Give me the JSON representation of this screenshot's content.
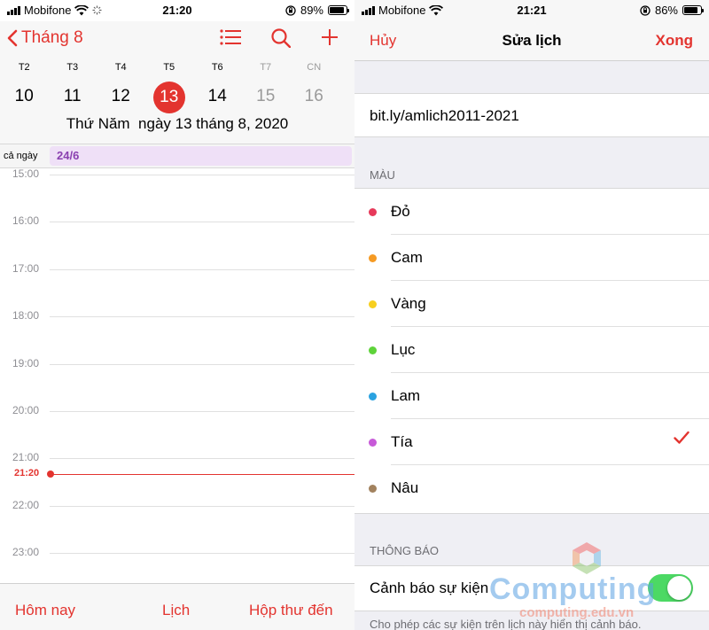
{
  "left": {
    "status": {
      "carrier": "Mobifone",
      "time": "21:20",
      "battery": "89%"
    },
    "header": {
      "back_label": "Tháng 8"
    },
    "weekdays": [
      "T2",
      "T3",
      "T4",
      "T5",
      "T6",
      "T7",
      "CN"
    ],
    "days": [
      "10",
      "11",
      "12",
      "13",
      "14",
      "15",
      "16"
    ],
    "selected_day_index": 3,
    "full_date": "Thứ Năm  ngày 13 tháng 8, 2020",
    "all_day_label": "cả ngày",
    "all_day_event": "24/6",
    "hours": [
      "15:00",
      "16:00",
      "17:00",
      "18:00",
      "19:00",
      "20:00",
      "21:00",
      "22:00",
      "23:00"
    ],
    "current_time": "21:20",
    "tabs": {
      "today": "Hôm nay",
      "calendars": "Lịch",
      "inbox": "Hộp thư đến"
    }
  },
  "right": {
    "status": {
      "carrier": "Mobifone",
      "time": "21:21",
      "battery": "86%"
    },
    "nav": {
      "cancel": "Hủy",
      "title": "Sửa lịch",
      "done": "Xong"
    },
    "calendar_name": "bit.ly/amlich2011-2021",
    "color_header": "MÀU",
    "colors": [
      {
        "name": "Đỏ",
        "color": "#e6395a"
      },
      {
        "name": "Cam",
        "color": "#f59a23"
      },
      {
        "name": "Vàng",
        "color": "#f7cf1f"
      },
      {
        "name": "Lục",
        "color": "#5ed33a"
      },
      {
        "name": "Lam",
        "color": "#2aa2e0"
      },
      {
        "name": "Tía",
        "color": "#c75ad8"
      },
      {
        "name": "Nâu",
        "color": "#a2825e"
      }
    ],
    "selected_color_index": 5,
    "notifications_header": "THÔNG BÁO",
    "event_alerts_label": "Cảnh báo sự kiện",
    "event_alerts_on": true,
    "footer_text": "Cho phép các sự kiện trên lịch này hiển thị cảnh báo."
  },
  "watermark": {
    "word": "Computing",
    "url": "computing.edu.vn"
  },
  "accent_color": "#e3342f"
}
